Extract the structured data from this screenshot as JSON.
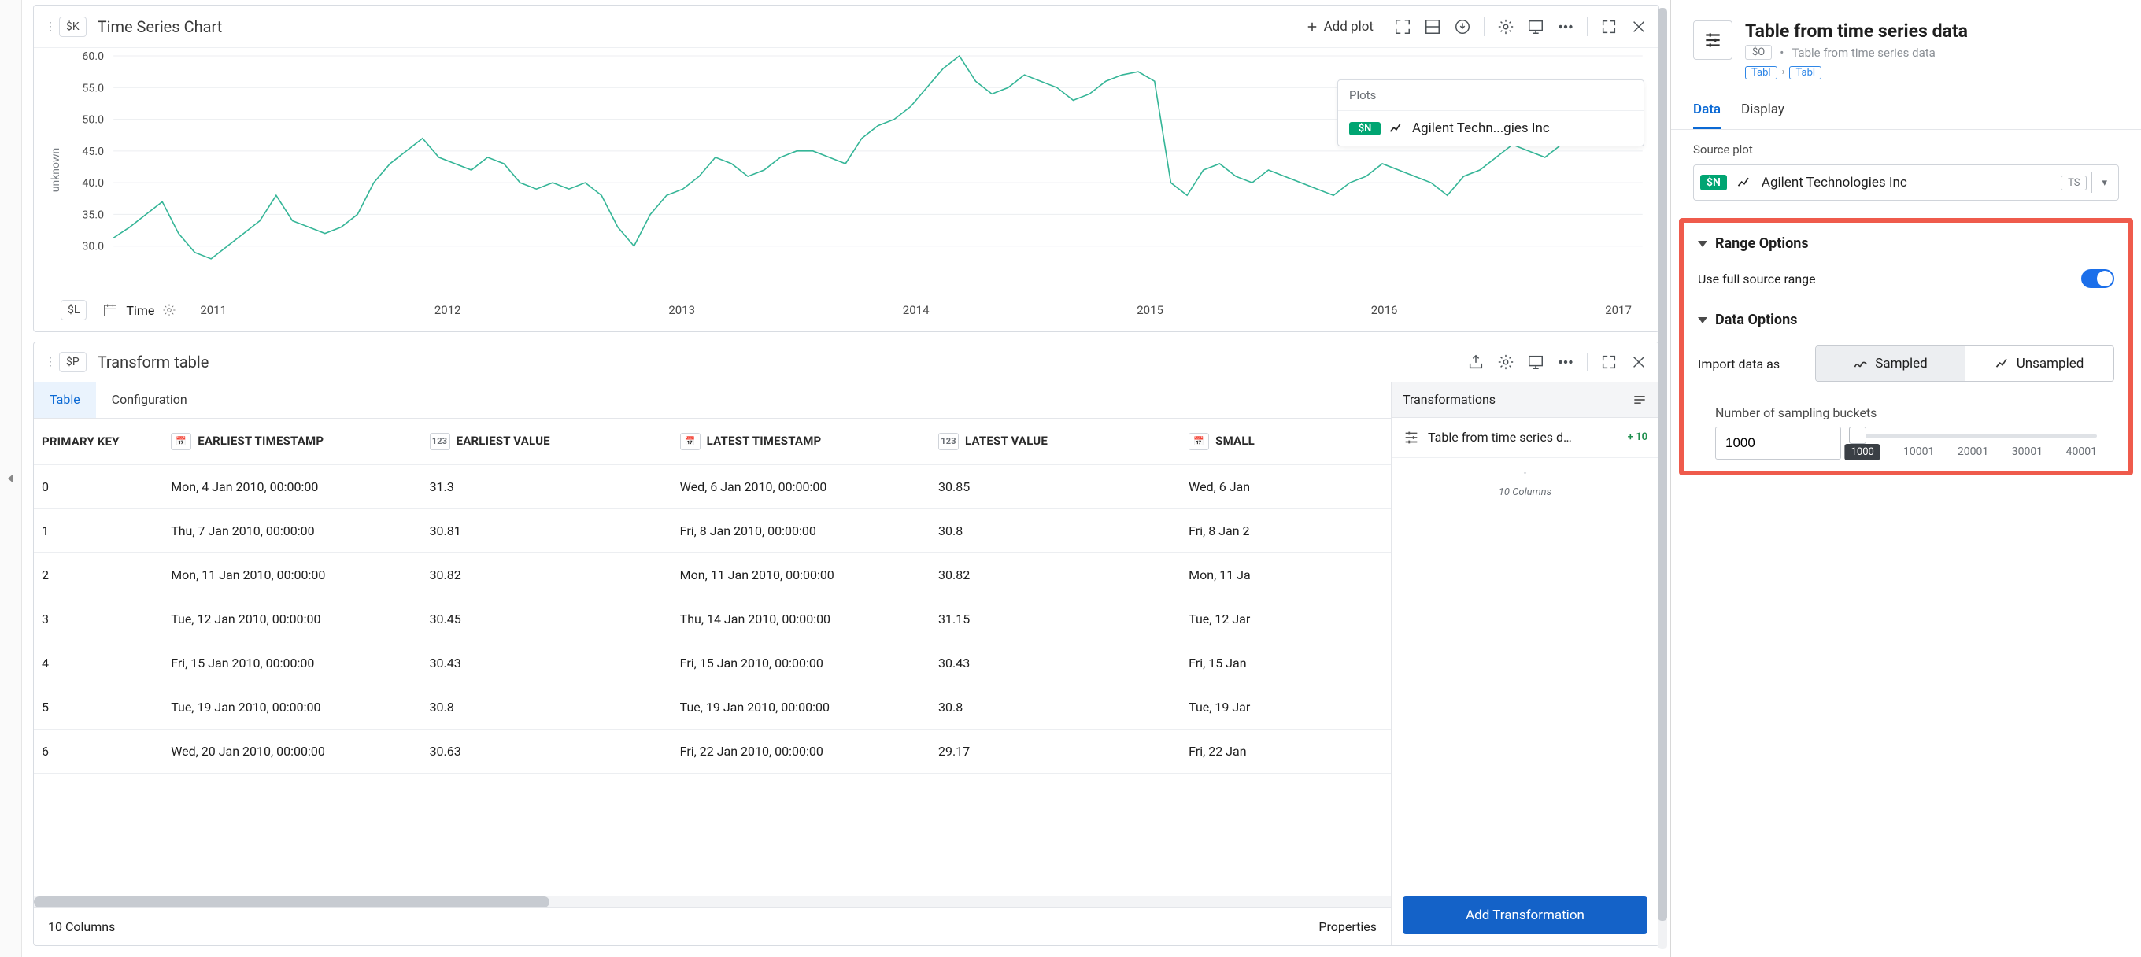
{
  "chart_panel": {
    "badge": "$K",
    "title": "Time Series Chart",
    "add_plot_label": "Add plot",
    "yaxis_label": "unknown",
    "legend": {
      "title": "Plots",
      "badge": "$N",
      "series_label": "Agilent Techn...gies Inc"
    },
    "time_row": {
      "badge": "$L",
      "label": "Time"
    }
  },
  "chart_data": {
    "type": "line",
    "title": "Time Series Chart",
    "xlabel": "Time",
    "ylabel": "unknown",
    "ylim": [
      25,
      60
    ],
    "x_ticks": [
      "2011",
      "2012",
      "2013",
      "2014",
      "2015",
      "2016",
      "2017"
    ],
    "y_ticks": [
      30.0,
      35.0,
      40.0,
      45.0,
      50.0,
      55.0,
      60.0
    ],
    "series": [
      {
        "name": "Agilent Technologies Inc",
        "color": "#35b597",
        "x_start": 2010.0,
        "x_end": 2017.3,
        "values": [
          31.3,
          33,
          35,
          37,
          32,
          29,
          28,
          30,
          32,
          34,
          38,
          34,
          33,
          32,
          33,
          35,
          40,
          43,
          45,
          47,
          44,
          43,
          42,
          44,
          43,
          40,
          39,
          40,
          39,
          40,
          38,
          33,
          30,
          35,
          38,
          39,
          41,
          44,
          43,
          41,
          42,
          44,
          45,
          45,
          44,
          43,
          47,
          49,
          50,
          52,
          55,
          58,
          60,
          56,
          54,
          55,
          57,
          56,
          55,
          53,
          54,
          56,
          57,
          57.5,
          56,
          40,
          38,
          42,
          43,
          41,
          40,
          42,
          41,
          40,
          39,
          38,
          40,
          41,
          43,
          42,
          41,
          40,
          38,
          41,
          42,
          44,
          46,
          45,
          44,
          46,
          47,
          48,
          47,
          49,
          48
        ]
      }
    ]
  },
  "table_panel": {
    "badge": "$P",
    "title": "Transform table",
    "tabs": {
      "table": "Table",
      "config": "Configuration"
    },
    "columns": [
      {
        "type": "key",
        "label": "PRIMARY KEY"
      },
      {
        "type": "date",
        "label": "EARLIEST TIMESTAMP"
      },
      {
        "type": "num",
        "label": "EARLIEST VALUE"
      },
      {
        "type": "date",
        "label": "LATEST TIMESTAMP"
      },
      {
        "type": "num",
        "label": "LATEST VALUE"
      },
      {
        "type": "date",
        "label": "SMALL"
      }
    ],
    "rows": [
      {
        "k": "0",
        "et": "Mon, 4 Jan 2010, 00:00:00",
        "ev": "31.3",
        "lt": "Wed, 6 Jan 2010, 00:00:00",
        "lv": "30.85",
        "sm": "Wed, 6 Jan"
      },
      {
        "k": "1",
        "et": "Thu, 7 Jan 2010, 00:00:00",
        "ev": "30.81",
        "lt": "Fri, 8 Jan 2010, 00:00:00",
        "lv": "30.8",
        "sm": "Fri, 8 Jan 2"
      },
      {
        "k": "2",
        "et": "Mon, 11 Jan 2010, 00:00:00",
        "ev": "30.82",
        "lt": "Mon, 11 Jan 2010, 00:00:00",
        "lv": "30.82",
        "sm": "Mon, 11 Ja"
      },
      {
        "k": "3",
        "et": "Tue, 12 Jan 2010, 00:00:00",
        "ev": "30.45",
        "lt": "Thu, 14 Jan 2010, 00:00:00",
        "lv": "31.15",
        "sm": "Tue, 12 Jar"
      },
      {
        "k": "4",
        "et": "Fri, 15 Jan 2010, 00:00:00",
        "ev": "30.43",
        "lt": "Fri, 15 Jan 2010, 00:00:00",
        "lv": "30.43",
        "sm": "Fri, 15 Jan"
      },
      {
        "k": "5",
        "et": "Tue, 19 Jan 2010, 00:00:00",
        "ev": "30.8",
        "lt": "Tue, 19 Jan 2010, 00:00:00",
        "lv": "30.8",
        "sm": "Tue, 19 Jar"
      },
      {
        "k": "6",
        "et": "Wed, 20 Jan 2010, 00:00:00",
        "ev": "30.63",
        "lt": "Fri, 22 Jan 2010, 00:00:00",
        "lv": "29.17",
        "sm": "Fri, 22 Jan"
      }
    ],
    "footer_left": "10 Columns",
    "footer_right": "Properties"
  },
  "transforms": {
    "header": "Transformations",
    "item_label": "Table from time series d…",
    "item_count": "+ 10",
    "columns_text": "10 Columns",
    "add_btn": "Add Transformation"
  },
  "right": {
    "title": "Table from time series data",
    "mini_badge": "$O",
    "breadcrumb_text": "Table from time series data",
    "chip1": "Tabl",
    "chip2": "Tabl",
    "tabs": {
      "data": "Data",
      "display": "Display"
    },
    "source_plot_label": "Source plot",
    "source": {
      "badge": "$N",
      "name": "Agilent Technologies Inc",
      "type": "TS"
    },
    "range_header": "Range Options",
    "range_label": "Use full source range",
    "data_header": "Data Options",
    "import_label": "Import data as",
    "seg": {
      "sampled": "Sampled",
      "unsampled": "Unsampled"
    },
    "buckets_label": "Number of sampling buckets",
    "buckets_value": "1000",
    "slider_ticks": [
      "1000",
      "10001",
      "20001",
      "30001",
      "40001"
    ],
    "slider_tooltip": "1000"
  }
}
